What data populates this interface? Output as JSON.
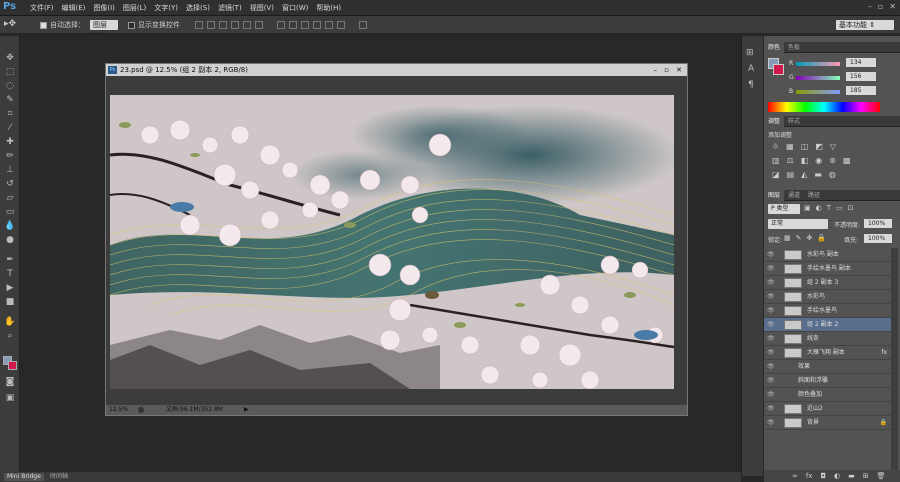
{
  "app": {
    "logo": "Ps"
  },
  "menu": [
    "文件(F)",
    "编辑(E)",
    "图像(I)",
    "图层(L)",
    "文字(Y)",
    "选择(S)",
    "滤镜(T)",
    "视图(V)",
    "窗口(W)",
    "帮助(H)"
  ],
  "options": {
    "auto_select": "自动选择：",
    "layer_select": "图层",
    "show_transform": "显示变换控件",
    "workspace": "基本功能"
  },
  "document": {
    "title": "23.psd @ 12.5% (组 2 副本 2, RGB/8)",
    "zoom": "12.5%",
    "doc_info": "文档:96.1M/352.8M"
  },
  "color_panel": {
    "tabs": [
      "颜色",
      "色板"
    ],
    "r_label": "R",
    "g_label": "G",
    "b_label": "B",
    "r": "134",
    "g": "156",
    "b": "185",
    "fg_color": "#869cb9",
    "bg_color": "#d0174a"
  },
  "adjust_panel": {
    "tabs": [
      "调整",
      "样式"
    ],
    "title": "添加调整"
  },
  "layers_panel": {
    "tabs": [
      "图层",
      "通道",
      "路径"
    ],
    "kind": "P 类型",
    "blend": "正常",
    "opacity_label": "不透明度:",
    "opacity": "100%",
    "lock_label": "锁定:",
    "fill_label": "填充:",
    "fill": "100%",
    "layers": [
      {
        "name": "水彩鸟 副本"
      },
      {
        "name": "手绘水墨鸟 副本"
      },
      {
        "name": "组 2 副本 3"
      },
      {
        "name": "水彩鸟"
      },
      {
        "name": "手绘水墨鸟"
      },
      {
        "name": "组 2 副本 2",
        "selected": true
      },
      {
        "name": "线条"
      },
      {
        "name": "大雁飞翔 副本",
        "fx": "fx"
      },
      {
        "name": "效果",
        "sub": true
      },
      {
        "name": "斜面和浮雕",
        "sub": true
      },
      {
        "name": "颜色叠加",
        "sub": true
      },
      {
        "name": "近山2"
      },
      {
        "name": "背景",
        "locked": true
      }
    ]
  },
  "bottom": {
    "mini_bridge": "Mini Bridge",
    "timeline": "时间轴"
  }
}
